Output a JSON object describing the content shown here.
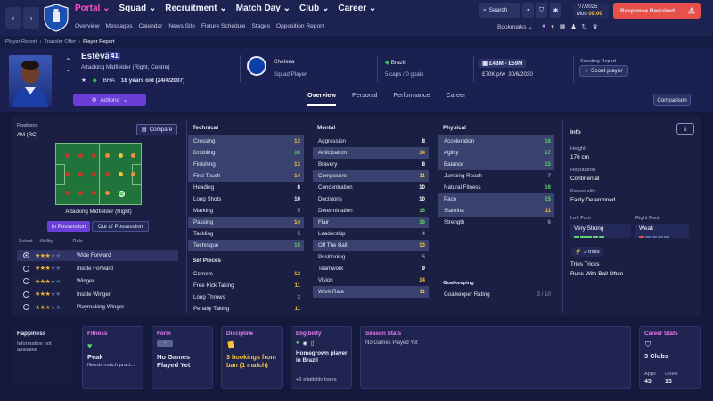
{
  "topbar": {
    "nav": [
      "Portal",
      "Squad",
      "Recruitment",
      "Match Day",
      "Club",
      "Career"
    ],
    "active_nav": "Portal",
    "subnav": [
      "Overview",
      "Messages",
      "Calendar",
      "News Site",
      "Fixture Schedule",
      "Stages",
      "Opposition Report"
    ],
    "search_label": "Search",
    "date": "7/7/2025",
    "day": "Mon",
    "time": "09:00",
    "response_label": "Response Required",
    "bookmarks_label": "Bookmarks"
  },
  "breadcrumb": [
    "Player Report",
    "Transfer Offer",
    "Player Report"
  ],
  "player": {
    "name": "Estêvão",
    "rating": "41",
    "position": "Attacking Midfielder (Right, Centre)",
    "nation_code": "BRA",
    "age": "18 years old (24/4/2007)",
    "actions_label": "Actions",
    "club": "Chelsea",
    "club_status": "Squad Player",
    "nation": "Brazil",
    "caps": "5 caps / 0 goals",
    "value": "£48M - £59M",
    "wage": "£70K p/w",
    "contract": "30/6/2030",
    "scouting_label": "Scouting Report",
    "scout_btn": "Scout player"
  },
  "tabs": [
    "Overview",
    "Personal",
    "Performance",
    "Career"
  ],
  "active_tab": "Overview",
  "comparison_label": "Comparison",
  "positions": {
    "label": "Positions",
    "value": "AM (RC)",
    "compare_label": "Compare",
    "role_label": "Attacking Midfielder (Right)",
    "in_possession": "In Possession",
    "out_possession": "Out of Possession",
    "headers": {
      "select": "Select",
      "ability": "Ability",
      "role": "Role"
    },
    "roles": [
      {
        "name": "Wide Forward",
        "stars": 3,
        "selected": true
      },
      {
        "name": "Inside Forward",
        "stars": 3,
        "selected": false
      },
      {
        "name": "Winger",
        "stars": 3,
        "selected": false
      },
      {
        "name": "Inside Winger",
        "stars": 3,
        "selected": false
      },
      {
        "name": "Playmaking Winger",
        "stars": 2.5,
        "selected": false
      }
    ]
  },
  "technical": {
    "title": "Technical",
    "items": [
      {
        "name": "Crossing",
        "value": "13",
        "hl": true
      },
      {
        "name": "Dribbling",
        "value": "16",
        "hl": true
      },
      {
        "name": "Finishing",
        "value": "13",
        "hl": true
      },
      {
        "name": "First Touch",
        "value": "14",
        "hl": true
      },
      {
        "name": "Heading",
        "value": "8",
        "hl": false
      },
      {
        "name": "Long Shots",
        "value": "10",
        "hl": false
      },
      {
        "name": "Marking",
        "value": "5",
        "hl": false
      },
      {
        "name": "Passing",
        "value": "14",
        "hl": true
      },
      {
        "name": "Tackling",
        "value": "5",
        "hl": false
      },
      {
        "name": "Technique",
        "value": "15",
        "hl": true
      }
    ]
  },
  "set_pieces": {
    "title": "Set Pieces",
    "items": [
      {
        "name": "Corners",
        "value": "12",
        "hl": false
      },
      {
        "name": "Free Kick Taking",
        "value": "11",
        "hl": false
      },
      {
        "name": "Long Throws",
        "value": "3",
        "hl": false
      },
      {
        "name": "Penalty Taking",
        "value": "11",
        "hl": false
      }
    ]
  },
  "mental": {
    "title": "Mental",
    "items": [
      {
        "name": "Aggression",
        "value": "8",
        "hl": false
      },
      {
        "name": "Anticipation",
        "value": "14",
        "hl": true
      },
      {
        "name": "Bravery",
        "value": "8",
        "hl": false
      },
      {
        "name": "Composure",
        "value": "11",
        "hl": true
      },
      {
        "name": "Concentration",
        "value": "10",
        "hl": false
      },
      {
        "name": "Decisions",
        "value": "10",
        "hl": false
      },
      {
        "name": "Determination",
        "value": "16",
        "hl": false
      },
      {
        "name": "Flair",
        "value": "16",
        "hl": true
      },
      {
        "name": "Leadership",
        "value": "4",
        "hl": false
      },
      {
        "name": "Off The Ball",
        "value": "13",
        "hl": true
      },
      {
        "name": "Positioning",
        "value": "5",
        "hl": false
      },
      {
        "name": "Teamwork",
        "value": "9",
        "hl": false
      },
      {
        "name": "Vision",
        "value": "14",
        "hl": false
      },
      {
        "name": "Work Rate",
        "value": "11",
        "hl": true
      }
    ]
  },
  "physical": {
    "title": "Physical",
    "items": [
      {
        "name": "Acceleration",
        "value": "16",
        "hl": true
      },
      {
        "name": "Agility",
        "value": "17",
        "hl": true
      },
      {
        "name": "Balance",
        "value": "15",
        "hl": true
      },
      {
        "name": "Jumping Reach",
        "value": "7",
        "hl": false
      },
      {
        "name": "Natural Fitness",
        "value": "16",
        "hl": false
      },
      {
        "name": "Pace",
        "value": "15",
        "hl": true
      },
      {
        "name": "Stamina",
        "value": "11",
        "hl": true
      },
      {
        "name": "Strength",
        "value": "6",
        "hl": false
      }
    ]
  },
  "goalkeeping": {
    "title": "Goalkeeping",
    "label": "Goalkeeper Rating",
    "value": "3 / 10"
  },
  "info": {
    "title": "Info",
    "height_label": "Height",
    "height": "176 cm",
    "reputation_label": "Reputation",
    "reputation": "Continental",
    "personality_label": "Personality",
    "personality": "Fairly Determined",
    "left_foot_label": "Left Foot",
    "left_foot": "Very Strong",
    "right_foot_label": "Right Foot",
    "right_foot": "Weak",
    "traits_label": "2 traits",
    "traits": [
      "Tries Tricks",
      "Runs With Ball Often"
    ]
  },
  "cards": {
    "happiness": {
      "title": "Happiness",
      "text": "Information not available"
    },
    "fitness": {
      "title": "Fitness",
      "value": "Peak",
      "sub": "Needs match pract..."
    },
    "form": {
      "title": "Form",
      "badge": "-",
      "value": "No Games Played Yet"
    },
    "discipline": {
      "title": "Discipline",
      "value": "3 bookings from ban (1 match)"
    },
    "eligibility": {
      "title": "Eligibility",
      "value": "Homegrown player in Brazil",
      "sub": "+2 eligibility types"
    },
    "season": {
      "title": "Season Stats",
      "value": "No Games Played Yet"
    },
    "career": {
      "title": "Career Stats",
      "value": "3 Clubs",
      "apps_label": "Apps",
      "apps": "43",
      "goals_label": "Goals",
      "goals": "13"
    }
  },
  "colors": {
    "accent": "#ff4fc8",
    "response": "#e8504a",
    "actions": "#6b3ed8",
    "pitch": "#20733a"
  }
}
